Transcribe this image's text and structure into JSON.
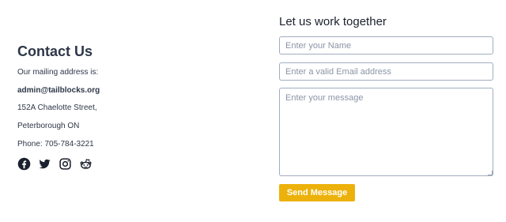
{
  "contact": {
    "title": "Contact Us",
    "mailing_label": "Our mailing address is:",
    "email": "admin@tailblocks.org",
    "street": "152A Chaelotte Street,",
    "city": "Peterborough ON",
    "phone": "Phone: 705-784-3221",
    "socials": [
      "facebook-icon",
      "twitter-icon",
      "instagram-icon",
      "reddit-icon"
    ]
  },
  "form": {
    "title": "Let us work together",
    "name_placeholder": "Enter your Name",
    "email_placeholder": "Enter a valid Email address",
    "message_placeholder": "Enter your message",
    "submit_label": "Send Message"
  },
  "colors": {
    "accent": "#ecb10a",
    "text": "#2d3748",
    "border": "#a0aec0"
  }
}
